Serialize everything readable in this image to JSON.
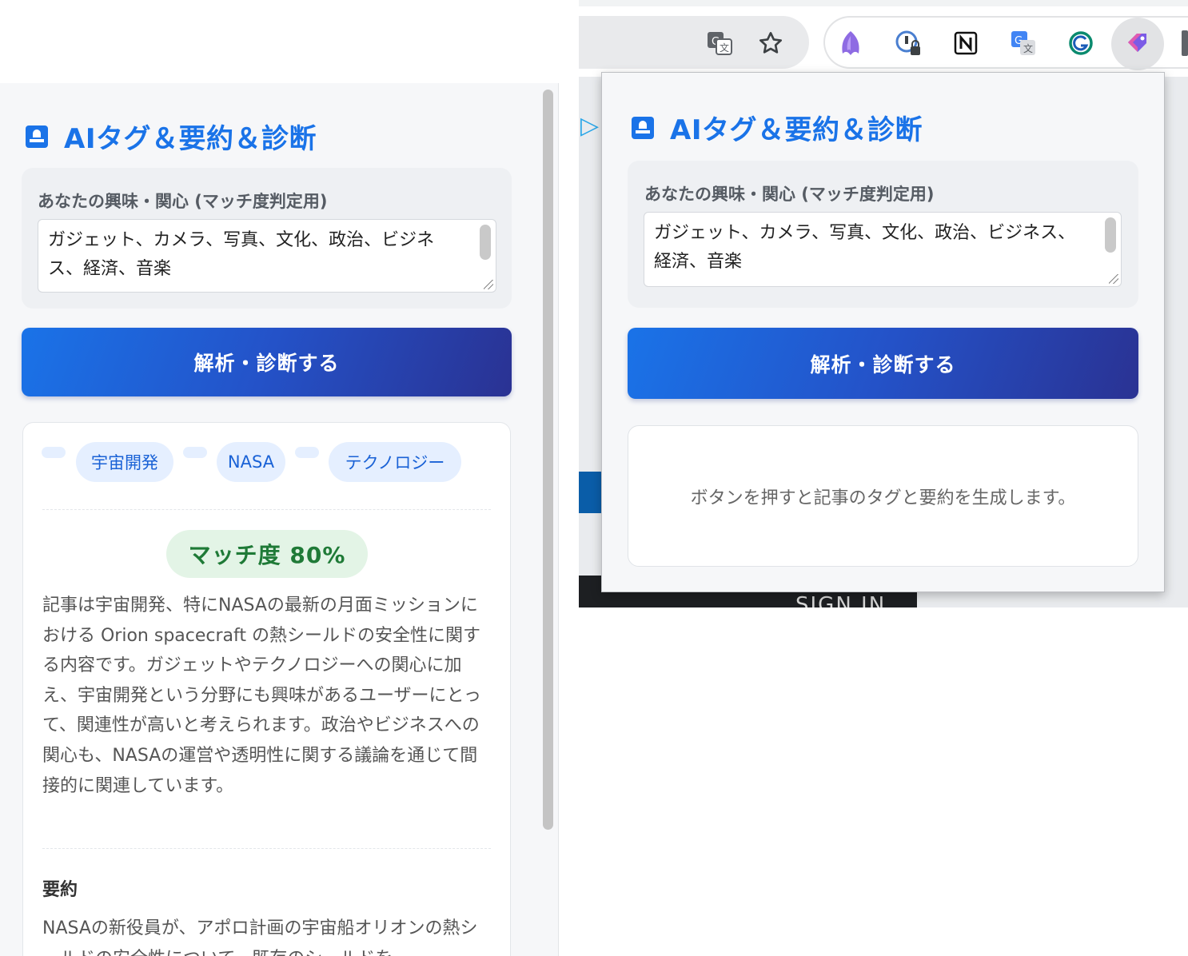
{
  "app": {
    "title": "AIタグ＆要約＆診断",
    "interest_label": "あなたの興味・関心 (マッチ度判定用)",
    "interest_value": "ガジェット、カメラ、写真、文化、政治、ビジネス、経済、音楽",
    "analyze_button": "解析・診断する"
  },
  "result": {
    "tags": [
      "宇宙開発",
      "NASA",
      "テクノロジー"
    ],
    "match_text": "マッチ度 80%",
    "match_percent": 80,
    "description": "記事は宇宙開発、特にNASAの最新の月面ミッションにおける Orion spacecraft の熱シールドの安全性に関する内容です。ガジェットやテクノロジーへの関心に加え、宇宙開発という分野にも興味があるユーザーにとって、関連性が高いと考えられます。政治やビジネスへの関心も、NASAの運営や透明性に関する議論を通じて間接的に関連しています。",
    "summary_heading": "要約",
    "summary_text": "NASAの新役員が、アポロ計画の宇宙船オリオンの熱シールドの安全性について、既存のシールドを"
  },
  "popup": {
    "placeholder_message": "ボタンを押すと記事のタグと要約を生成します。"
  },
  "page": {
    "sign_in": "SIGN IN"
  },
  "icons": {
    "translate": "translate-icon",
    "bookmark": "star-icon",
    "extensions": [
      "ghost-extension-icon",
      "lock-info-extension-icon",
      "notion-icon",
      "google-translate-icon",
      "grammar-extension-icon",
      "tag-extension-icon"
    ]
  },
  "colors": {
    "accent": "#1a73e8",
    "button_gradient_end": "#2a3293",
    "tag_bg": "#e5efff",
    "match_bg": "#e3f4e6",
    "match_text": "#1f7a37"
  }
}
